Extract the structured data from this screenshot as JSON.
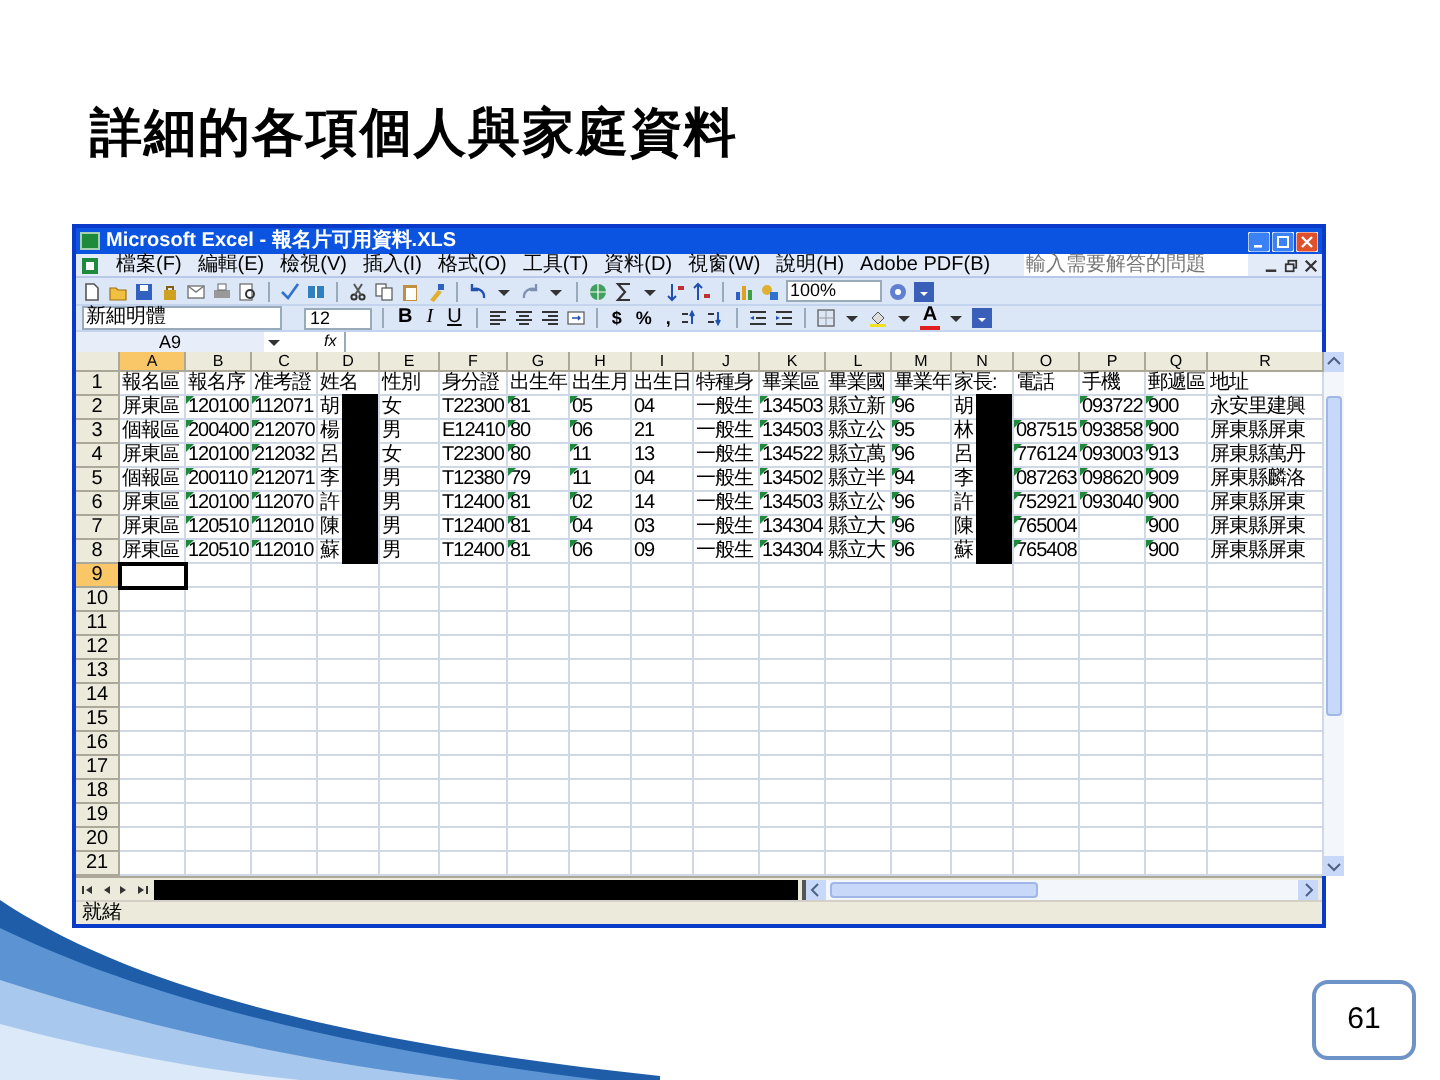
{
  "slide": {
    "title": "詳細的各項個人與家庭資料",
    "page_number": "61"
  },
  "window": {
    "title": "Microsoft Excel - 報名片可用資料.XLS"
  },
  "menu": [
    "檔案(F)",
    "編輯(E)",
    "檢視(V)",
    "插入(I)",
    "格式(O)",
    "工具(T)",
    "資料(D)",
    "視窗(W)",
    "說明(H)",
    "Adobe PDF(B)"
  ],
  "help_box": {
    "placeholder": "輸入需要解答的問題"
  },
  "zoom_field": {
    "value": "100%"
  },
  "font_field": {
    "value": "新細明體"
  },
  "size_field": {
    "value": "12"
  },
  "format_buttons": [
    {
      "label": "B",
      "kind": "bold"
    },
    {
      "label": "I",
      "kind": "italic"
    },
    {
      "label": "U",
      "kind": "underline"
    }
  ],
  "number_buttons": [
    "$",
    "%",
    ","
  ],
  "font_color_button": "A",
  "name_box": {
    "value": "A9"
  },
  "formula_label": "fx",
  "columns": [
    {
      "label": "A",
      "selected": true,
      "redacted": false,
      "flagged": false
    },
    {
      "label": "B",
      "selected": false,
      "redacted": false,
      "flagged": true
    },
    {
      "label": "C",
      "selected": false,
      "redacted": false,
      "flagged": true
    },
    {
      "label": "D",
      "selected": false,
      "redacted": true,
      "flagged": false
    },
    {
      "label": "E",
      "selected": false,
      "redacted": false,
      "flagged": false
    },
    {
      "label": "F",
      "selected": false,
      "redacted": false,
      "flagged": false
    },
    {
      "label": "G",
      "selected": false,
      "redacted": false,
      "flagged": true
    },
    {
      "label": "H",
      "selected": false,
      "redacted": false,
      "flagged": true
    },
    {
      "label": "I",
      "selected": false,
      "redacted": false,
      "flagged": false
    },
    {
      "label": "J",
      "selected": false,
      "redacted": false,
      "flagged": false
    },
    {
      "label": "K",
      "selected": false,
      "redacted": false,
      "flagged": true
    },
    {
      "label": "L",
      "selected": false,
      "redacted": false,
      "flagged": false
    },
    {
      "label": "M",
      "selected": false,
      "redacted": false,
      "flagged": true
    },
    {
      "label": "N",
      "selected": false,
      "redacted": true,
      "flagged": false
    },
    {
      "label": "O",
      "selected": false,
      "redacted": false,
      "flagged": true
    },
    {
      "label": "P",
      "selected": false,
      "redacted": false,
      "flagged": true
    },
    {
      "label": "Q",
      "selected": false,
      "redacted": false,
      "flagged": true
    },
    {
      "label": "R",
      "selected": false,
      "redacted": false,
      "flagged": false
    }
  ],
  "rows": [
    {
      "number": "1",
      "selected": false,
      "cells": [
        "報名區",
        "報名序",
        "准考證",
        "姓名",
        "性別",
        "身分證",
        "出生年",
        "出生月",
        "出生日",
        "特種身",
        "畢業區",
        "畢業國",
        "畢業年",
        "家長:",
        "電話",
        "手機",
        "郵遞區",
        "地址"
      ]
    },
    {
      "number": "2",
      "selected": false,
      "cells": [
        "屏東區",
        "120100",
        "112071",
        "胡",
        "女",
        "T22300",
        "81",
        "05",
        "04",
        "一般生",
        "134503",
        "縣立新",
        "96",
        "胡",
        "",
        "093722",
        "900",
        "永安里建興"
      ]
    },
    {
      "number": "3",
      "selected": false,
      "cells": [
        "個報區",
        "200400",
        "212070",
        "楊",
        "男",
        "E12410",
        "80",
        "06",
        "21",
        "一般生",
        "134503",
        "縣立公",
        "95",
        "林",
        "087515",
        "093858",
        "900",
        "屏東縣屏東"
      ]
    },
    {
      "number": "4",
      "selected": false,
      "cells": [
        "屏東區",
        "120100",
        "212032",
        "呂",
        "女",
        "T22300",
        "80",
        "11",
        "13",
        "一般生",
        "134522",
        "縣立萬",
        "96",
        "呂",
        "776124",
        "093003",
        "913",
        "屏東縣萬丹"
      ]
    },
    {
      "number": "5",
      "selected": false,
      "cells": [
        "個報區",
        "200110",
        "212071",
        "李",
        "男",
        "T12380",
        "79",
        "11",
        "04",
        "一般生",
        "134502",
        "縣立半",
        "94",
        "李",
        "087263",
        "098620",
        "909",
        "屏東縣麟洛"
      ]
    },
    {
      "number": "6",
      "selected": false,
      "cells": [
        "屏東區",
        "120100",
        "112070",
        "許",
        "男",
        "T12400",
        "81",
        "02",
        "14",
        "一般生",
        "134503",
        "縣立公",
        "96",
        "許",
        "752921",
        "093040",
        "900",
        "屏東縣屏東"
      ]
    },
    {
      "number": "7",
      "selected": false,
      "cells": [
        "屏東區",
        "120510",
        "112010",
        "陳",
        "男",
        "T12400",
        "81",
        "04",
        "03",
        "一般生",
        "134304",
        "縣立大",
        "96",
        "陳",
        "765004",
        "",
        "900",
        "屏東縣屏東"
      ]
    },
    {
      "number": "8",
      "selected": false,
      "cells": [
        "屏東區",
        "120510",
        "112010",
        "蘇",
        "男",
        "T12400",
        "81",
        "06",
        "09",
        "一般生",
        "134304",
        "縣立大",
        "96",
        "蘇",
        "765408",
        "",
        "900",
        "屏東縣屏東"
      ]
    },
    {
      "number": "9",
      "selected": true
    },
    {
      "number": "10",
      "selected": false
    },
    {
      "number": "11",
      "selected": false
    },
    {
      "number": "12",
      "selected": false
    },
    {
      "number": "13",
      "selected": false
    },
    {
      "number": "14",
      "selected": false
    },
    {
      "number": "15",
      "selected": false
    },
    {
      "number": "16",
      "selected": false
    },
    {
      "number": "17",
      "selected": false
    },
    {
      "number": "18",
      "selected": false
    },
    {
      "number": "19",
      "selected": false
    },
    {
      "number": "20",
      "selected": false
    },
    {
      "number": "21",
      "selected": false
    }
  ],
  "status_bar": {
    "text": "就緒"
  }
}
